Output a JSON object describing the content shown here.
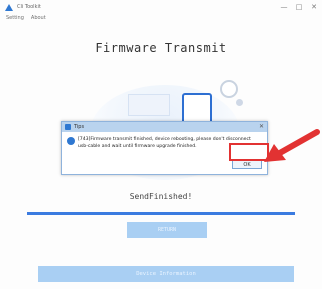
{
  "window": {
    "title": "Cli Toolkit",
    "minimize": "—",
    "maximize": "□",
    "close": "✕"
  },
  "menu": {
    "items": [
      "Setting",
      "About"
    ]
  },
  "page": {
    "title": "Firmware Transmit",
    "status": "SendFinished!",
    "progress": 1.0
  },
  "dialog": {
    "title": "Tips",
    "message": "[743]Firmware transmit finished, device rebooting, please don't disconnect usb-cable and wait until firmware upgrade finished.",
    "ok_label": "OK",
    "close": "✕"
  },
  "buttons": {
    "return_label": "RETURN",
    "device_info_label": "Device Information"
  },
  "colors": {
    "accent": "#3b7be0",
    "button_bg": "#a9cff3",
    "annotation": "#e23232"
  }
}
